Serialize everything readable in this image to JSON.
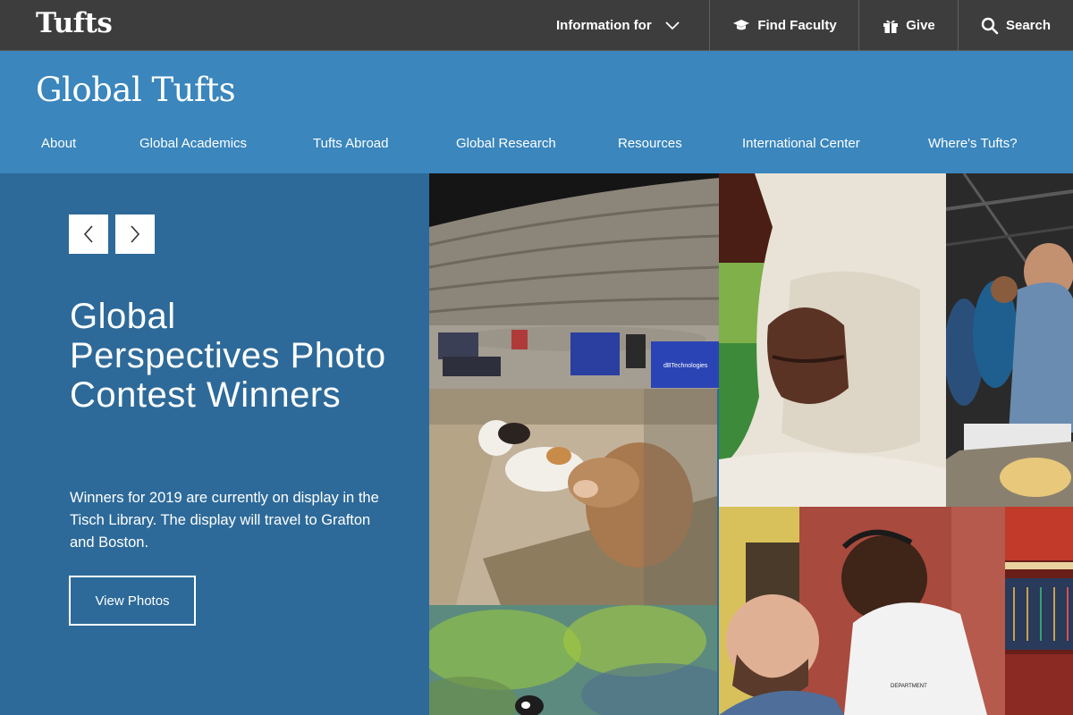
{
  "brand": {
    "logo": "Tufts",
    "site_title": "Global Tufts"
  },
  "utility_nav": {
    "information_for": "Information for",
    "find_faculty": "Find Faculty",
    "give": "Give",
    "search": "Search"
  },
  "main_nav": [
    {
      "label": "About"
    },
    {
      "label": "Global Academics"
    },
    {
      "label": "Tufts Abroad"
    },
    {
      "label": "Global Research"
    },
    {
      "label": "Resources"
    },
    {
      "label": "International Center"
    },
    {
      "label": "Where's Tufts?"
    }
  ],
  "hero": {
    "title": "Global Perspectives Photo Contest Winners",
    "description": "Winners for 2019 are currently on display in the Tisch Library. The display will travel to Grafton and Boston.",
    "cta": "View Photos"
  },
  "photos": {
    "amphitheater_case_label": "dBTechnologies",
    "vendor_shirt_text": "DEPARTMENT"
  },
  "colors": {
    "topbar": "#3d3d3d",
    "header_blue": "#3a86bd",
    "hero_blue": "#2d6a99",
    "white": "#ffffff"
  }
}
